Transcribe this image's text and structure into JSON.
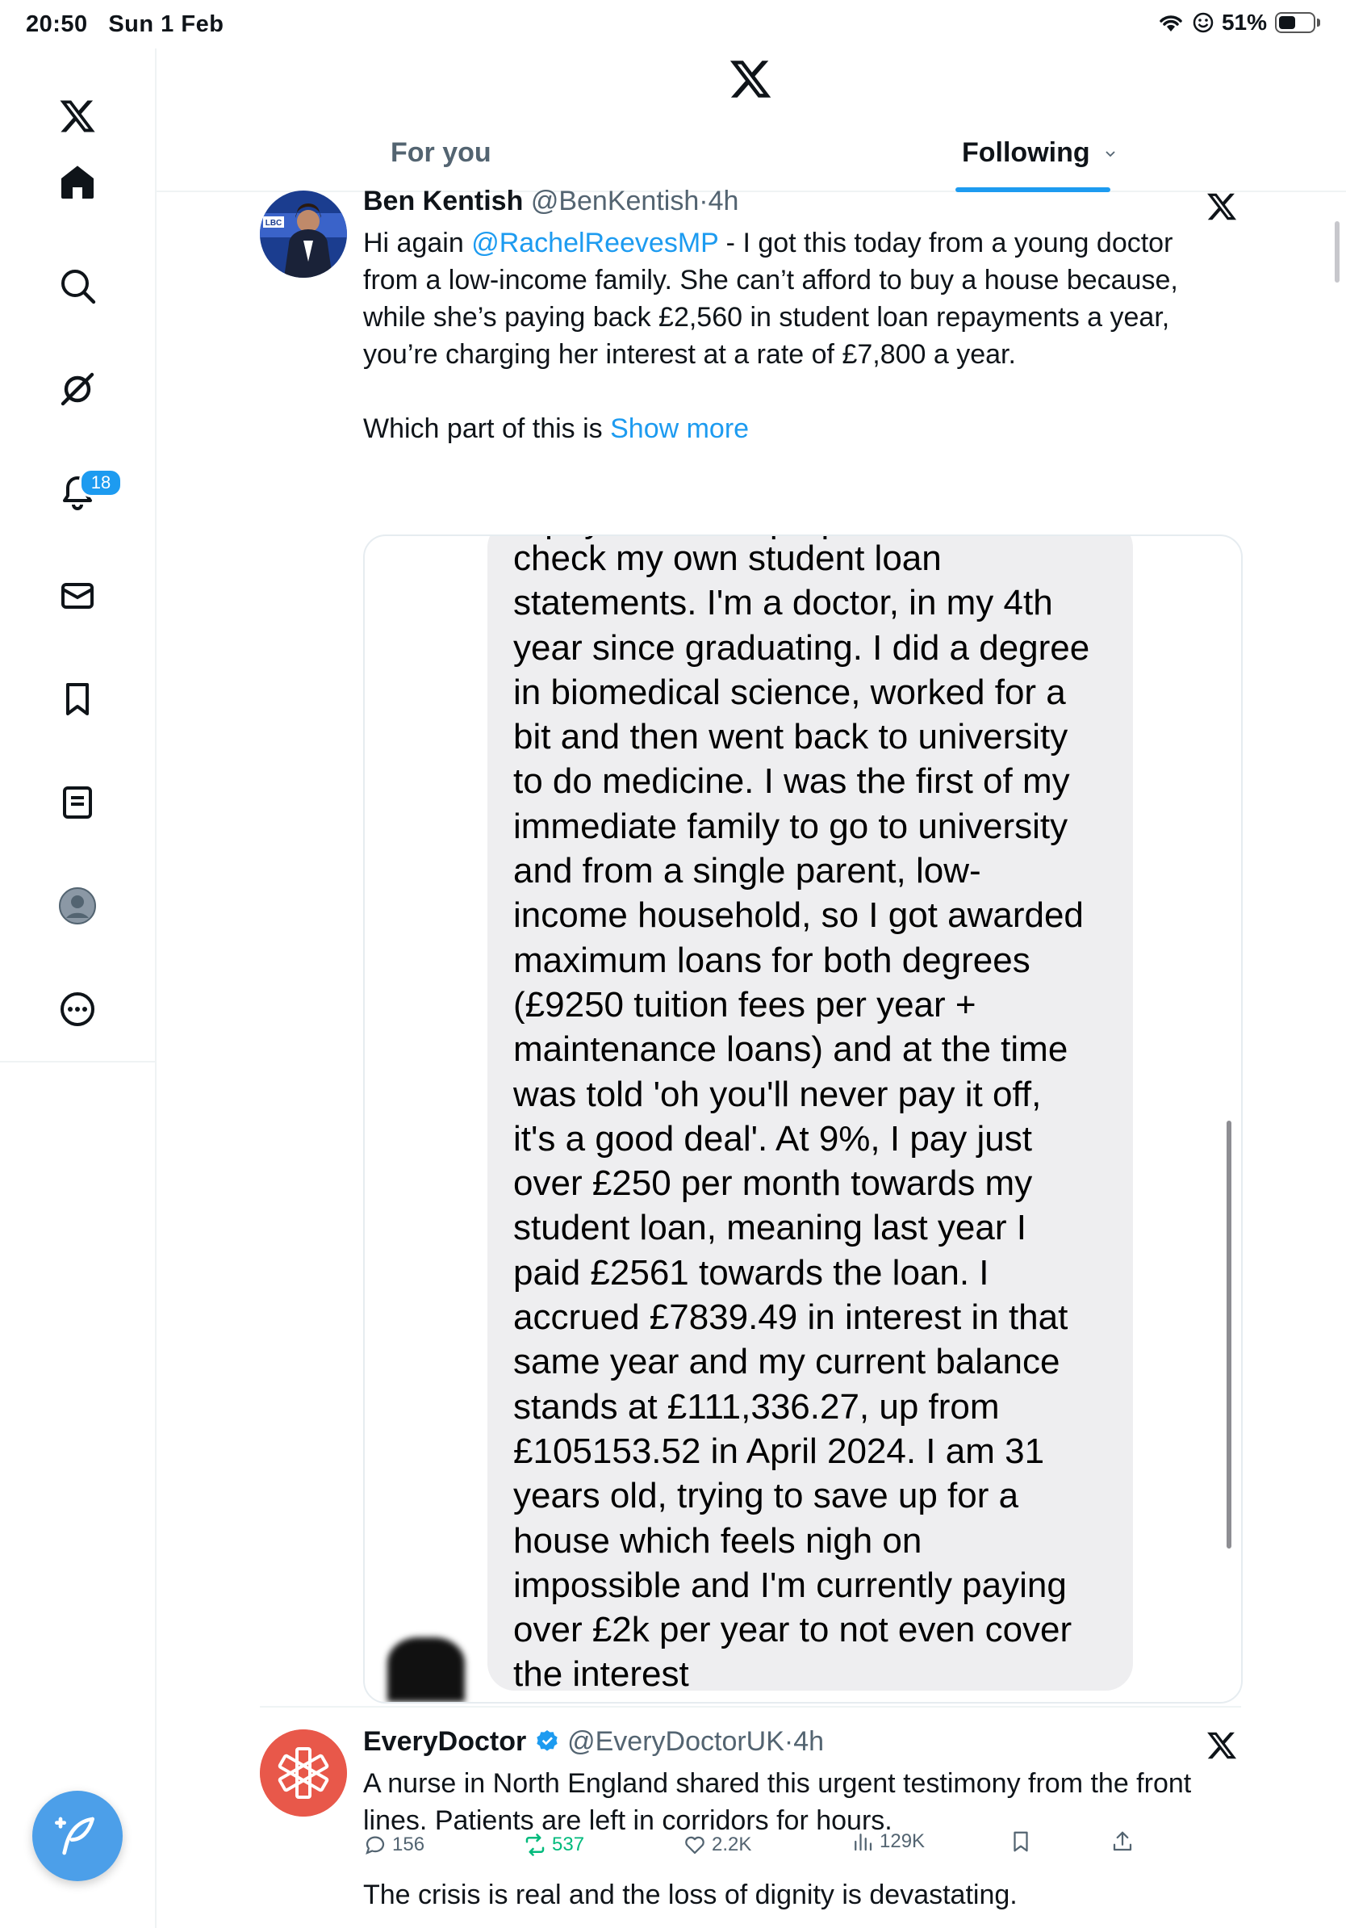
{
  "status": {
    "time": "20:50",
    "date": "Sun 1 Feb",
    "battery": "51%",
    "battery_level": 0.51
  },
  "sidebar": {
    "items": [
      {
        "name": "home",
        "icon": "home-icon"
      },
      {
        "name": "explore",
        "icon": "search-icon"
      },
      {
        "name": "grok",
        "icon": "grok-icon"
      },
      {
        "name": "notifications",
        "icon": "bell-icon",
        "badge": "18"
      },
      {
        "name": "messages",
        "icon": "mail-icon"
      },
      {
        "name": "bookmarks",
        "icon": "bookmark-icon"
      },
      {
        "name": "lists",
        "icon": "list-icon"
      },
      {
        "name": "profile",
        "icon": "avatar-icon"
      },
      {
        "name": "more",
        "icon": "more-icon"
      }
    ],
    "compose_icon": "compose-icon"
  },
  "tabs": [
    {
      "label": "For you",
      "active": false
    },
    {
      "label": "Following",
      "active": true
    }
  ],
  "tweets": [
    {
      "name": "Ben Kentish",
      "handle": "@BenKentish",
      "time": "4h",
      "text_pre": "Hi again ",
      "mention": "@RachelReevesMP",
      "text_main": " - I got this today from a young doctor from a low-income family. She can’t afford to buy a house because, while she’s paying back £2,560 in student loan repayments a year, you’re charging her interest at a rate of £7,800 a year.",
      "text_tail": "Which part of this is ",
      "show_more": "Show more",
      "image_text_lines": [
        "check my own student loan",
        "statements. I'm a doctor, in my 4th",
        "year since graduating. I did a degree",
        "in biomedical science, worked for a",
        "bit and then went back to university",
        "to do medicine. I was the first of my",
        "immediate family to go to university",
        "and from a single parent, low-",
        "income household, so I got awarded",
        "maximum loans for both degrees",
        "(£9250 tuition fees per year +",
        "maintenance loans) and at the time",
        "was told 'oh you'll never pay it off,",
        "it's a good deal'. At 9%, I pay just",
        "over £250 per month towards my",
        "student loan, meaning last year I",
        "paid £2561 towards the loan. I",
        "accrued £7839.49 in interest in that",
        "same year and my current balance",
        "stands at £111,336.27, up from",
        "£105153.52 in April 2024. I am 31",
        "years old, trying to save up for a",
        "house which feels nigh on",
        "impossible and I'm currently paying",
        "over £2k per year to not even cover",
        "the interest"
      ],
      "avatar_badge": "LBC",
      "stats": {
        "replies": "156",
        "reposts": "537",
        "likes": "2.2K",
        "views": "129K"
      }
    },
    {
      "name": "EveryDoctor",
      "handle": "@EveryDoctorUK",
      "time": "4h",
      "verified": true,
      "text_1": "A nurse in North England shared this urgent testimony from the front lines. Patients are left in corridors for hours.",
      "text_2": "The crisis is real and the loss of dignity is devastating."
    }
  ],
  "colors": {
    "accent": "#1d9bf0",
    "repost_green": "#00ba7c",
    "secondary_text": "#536471",
    "everydoctor_red": "#e8584a"
  }
}
